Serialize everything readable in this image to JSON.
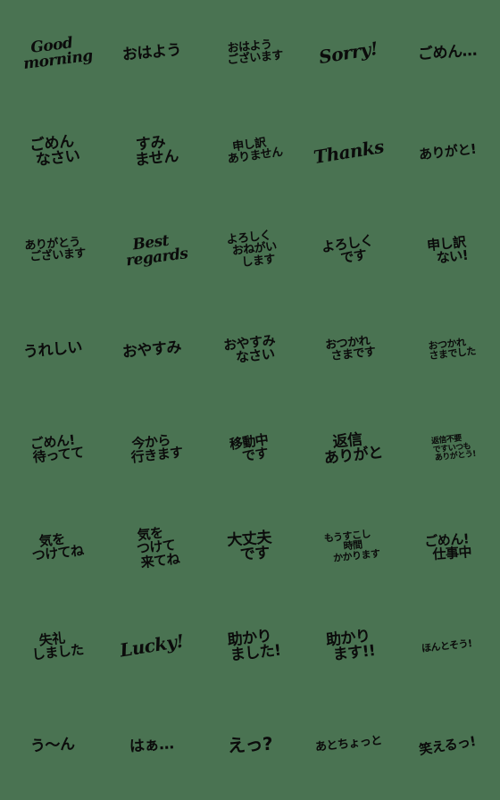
{
  "sheet": {
    "title": "Japanese handwritten greeting emoji sticker sheet",
    "background_color": "#4a7352",
    "ink_color": "#0b0b0b",
    "columns": 5,
    "rows": 8,
    "total_stickers": 40
  },
  "stickers": [
    {
      "id": "r1c1",
      "lines": [
        "Good",
        "morning"
      ],
      "script": "latin",
      "size": "lg",
      "tilt": "a"
    },
    {
      "id": "r1c2",
      "lines": [
        "おはよう"
      ],
      "script": "jp",
      "size": "lg",
      "tilt": "b"
    },
    {
      "id": "r1c3",
      "lines": [
        "おはよう",
        "ございます"
      ],
      "script": "jp",
      "size": "sm",
      "tilt": "b"
    },
    {
      "id": "r1c4",
      "lines": [
        "Sorry!"
      ],
      "script": "latin",
      "size": "xl",
      "tilt": "c"
    },
    {
      "id": "r1c5",
      "lines": [
        "ごめん…"
      ],
      "script": "jp",
      "size": "lg",
      "tilt": "d"
    },
    {
      "id": "r2c1",
      "lines": [
        "ごめん",
        "なさい"
      ],
      "script": "jp",
      "size": "lg",
      "tilt": "e"
    },
    {
      "id": "r2c2",
      "lines": [
        "すみ",
        "ません"
      ],
      "script": "jp",
      "size": "lg",
      "tilt": "e"
    },
    {
      "id": "r2c3",
      "lines": [
        "申し訳",
        "ありません"
      ],
      "script": "jp",
      "size": "sm",
      "tilt": "f"
    },
    {
      "id": "r2c4",
      "lines": [
        "Thanks"
      ],
      "script": "latin",
      "size": "xl",
      "tilt": "c"
    },
    {
      "id": "r2c5",
      "lines": [
        "ありがと!"
      ],
      "script": "jp",
      "size": "md",
      "tilt": "e"
    },
    {
      "id": "r3c1",
      "lines": [
        "ありがとう",
        "ございます"
      ],
      "script": "jp",
      "size": "sm",
      "tilt": "d"
    },
    {
      "id": "r3c2",
      "lines": [
        "Best",
        "regards"
      ],
      "script": "latin",
      "size": "lg",
      "tilt": "a"
    },
    {
      "id": "r3c3",
      "lines": [
        "よろしく",
        "おねがい",
        "します"
      ],
      "script": "jp",
      "size": "sm",
      "tilt": "e"
    },
    {
      "id": "r3c4",
      "lines": [
        "よろしく",
        "です"
      ],
      "script": "jp",
      "size": "md",
      "tilt": "f"
    },
    {
      "id": "r3c5",
      "lines": [
        "申し訳",
        "ない!"
      ],
      "script": "jp",
      "size": "md",
      "tilt": "e"
    },
    {
      "id": "r4c1",
      "lines": [
        "うれしい"
      ],
      "script": "jp",
      "size": "lg",
      "tilt": "b"
    },
    {
      "id": "r4c2",
      "lines": [
        "おやすみ"
      ],
      "script": "jp",
      "size": "lg",
      "tilt": "b"
    },
    {
      "id": "r4c3",
      "lines": [
        "おやすみ",
        "なさい"
      ],
      "script": "jp",
      "size": "md",
      "tilt": "e"
    },
    {
      "id": "r4c4",
      "lines": [
        "おつかれ",
        "さまです"
      ],
      "script": "jp",
      "size": "sm",
      "tilt": "e"
    },
    {
      "id": "r4c5",
      "lines": [
        "おつかれ",
        "さまでした"
      ],
      "script": "jp",
      "size": "xs",
      "tilt": "e"
    },
    {
      "id": "r5c1",
      "lines": [
        "ごめん!",
        "待ってて"
      ],
      "script": "jp",
      "size": "md",
      "tilt": "e"
    },
    {
      "id": "r5c2",
      "lines": [
        "今から",
        "行きます"
      ],
      "script": "jp",
      "size": "md",
      "tilt": "e"
    },
    {
      "id": "r5c3",
      "lines": [
        "移動中",
        "です"
      ],
      "script": "jp",
      "size": "md",
      "tilt": "f"
    },
    {
      "id": "r5c4",
      "lines": [
        "返信",
        "ありがと"
      ],
      "script": "jp",
      "size": "lg",
      "tilt": "e"
    },
    {
      "id": "r5c5",
      "lines": [
        "返信不要",
        "ですいつも",
        "ありがとう!"
      ],
      "script": "jp",
      "size": "xxs",
      "tilt": "e"
    },
    {
      "id": "r6c1",
      "lines": [
        "気を",
        "つけてね"
      ],
      "script": "jp",
      "size": "md",
      "tilt": "e"
    },
    {
      "id": "r6c2",
      "lines": [
        "気を",
        "つけて",
        "来てね"
      ],
      "script": "jp",
      "size": "md",
      "tilt": "e"
    },
    {
      "id": "r6c3",
      "lines": [
        "大丈夫",
        "です"
      ],
      "script": "jp",
      "size": "lg",
      "tilt": "d"
    },
    {
      "id": "r6c4",
      "lines": [
        "もうすこし",
        "時間",
        "かかります"
      ],
      "script": "jp",
      "size": "xs",
      "tilt": "e"
    },
    {
      "id": "r6c5",
      "lines": [
        "ごめん!",
        "仕事中"
      ],
      "script": "jp",
      "size": "md",
      "tilt": "d"
    },
    {
      "id": "r7c1",
      "lines": [
        "失礼",
        "しました"
      ],
      "script": "jp",
      "size": "md",
      "tilt": "e"
    },
    {
      "id": "r7c2",
      "lines": [
        "Lucky!"
      ],
      "script": "latin",
      "size": "xl",
      "tilt": "c"
    },
    {
      "id": "r7c3",
      "lines": [
        "助かり",
        "ました!"
      ],
      "script": "jp",
      "size": "lg",
      "tilt": "e"
    },
    {
      "id": "r7c4",
      "lines": [
        "助かり",
        "ます!!"
      ],
      "script": "jp",
      "size": "lg",
      "tilt": "e"
    },
    {
      "id": "r7c5",
      "lines": [
        "ほんとそう!"
      ],
      "script": "jp",
      "size": "xs",
      "tilt": "e"
    },
    {
      "id": "r8c1",
      "lines": [
        "う〜ん"
      ],
      "script": "jp",
      "size": "lg",
      "tilt": "g"
    },
    {
      "id": "r8c2",
      "lines": [
        "はぁ…"
      ],
      "script": "jp",
      "size": "lg",
      "tilt": "d"
    },
    {
      "id": "r8c3",
      "lines": [
        "えっ?"
      ],
      "script": "jp",
      "size": "xl",
      "tilt": "g"
    },
    {
      "id": "r8c4",
      "lines": [
        "あとちょっと"
      ],
      "script": "jp",
      "size": "sm",
      "tilt": "e"
    },
    {
      "id": "r8c5",
      "lines": [
        "笑えるっ!"
      ],
      "script": "jp",
      "size": "md",
      "tilt": "c"
    }
  ]
}
